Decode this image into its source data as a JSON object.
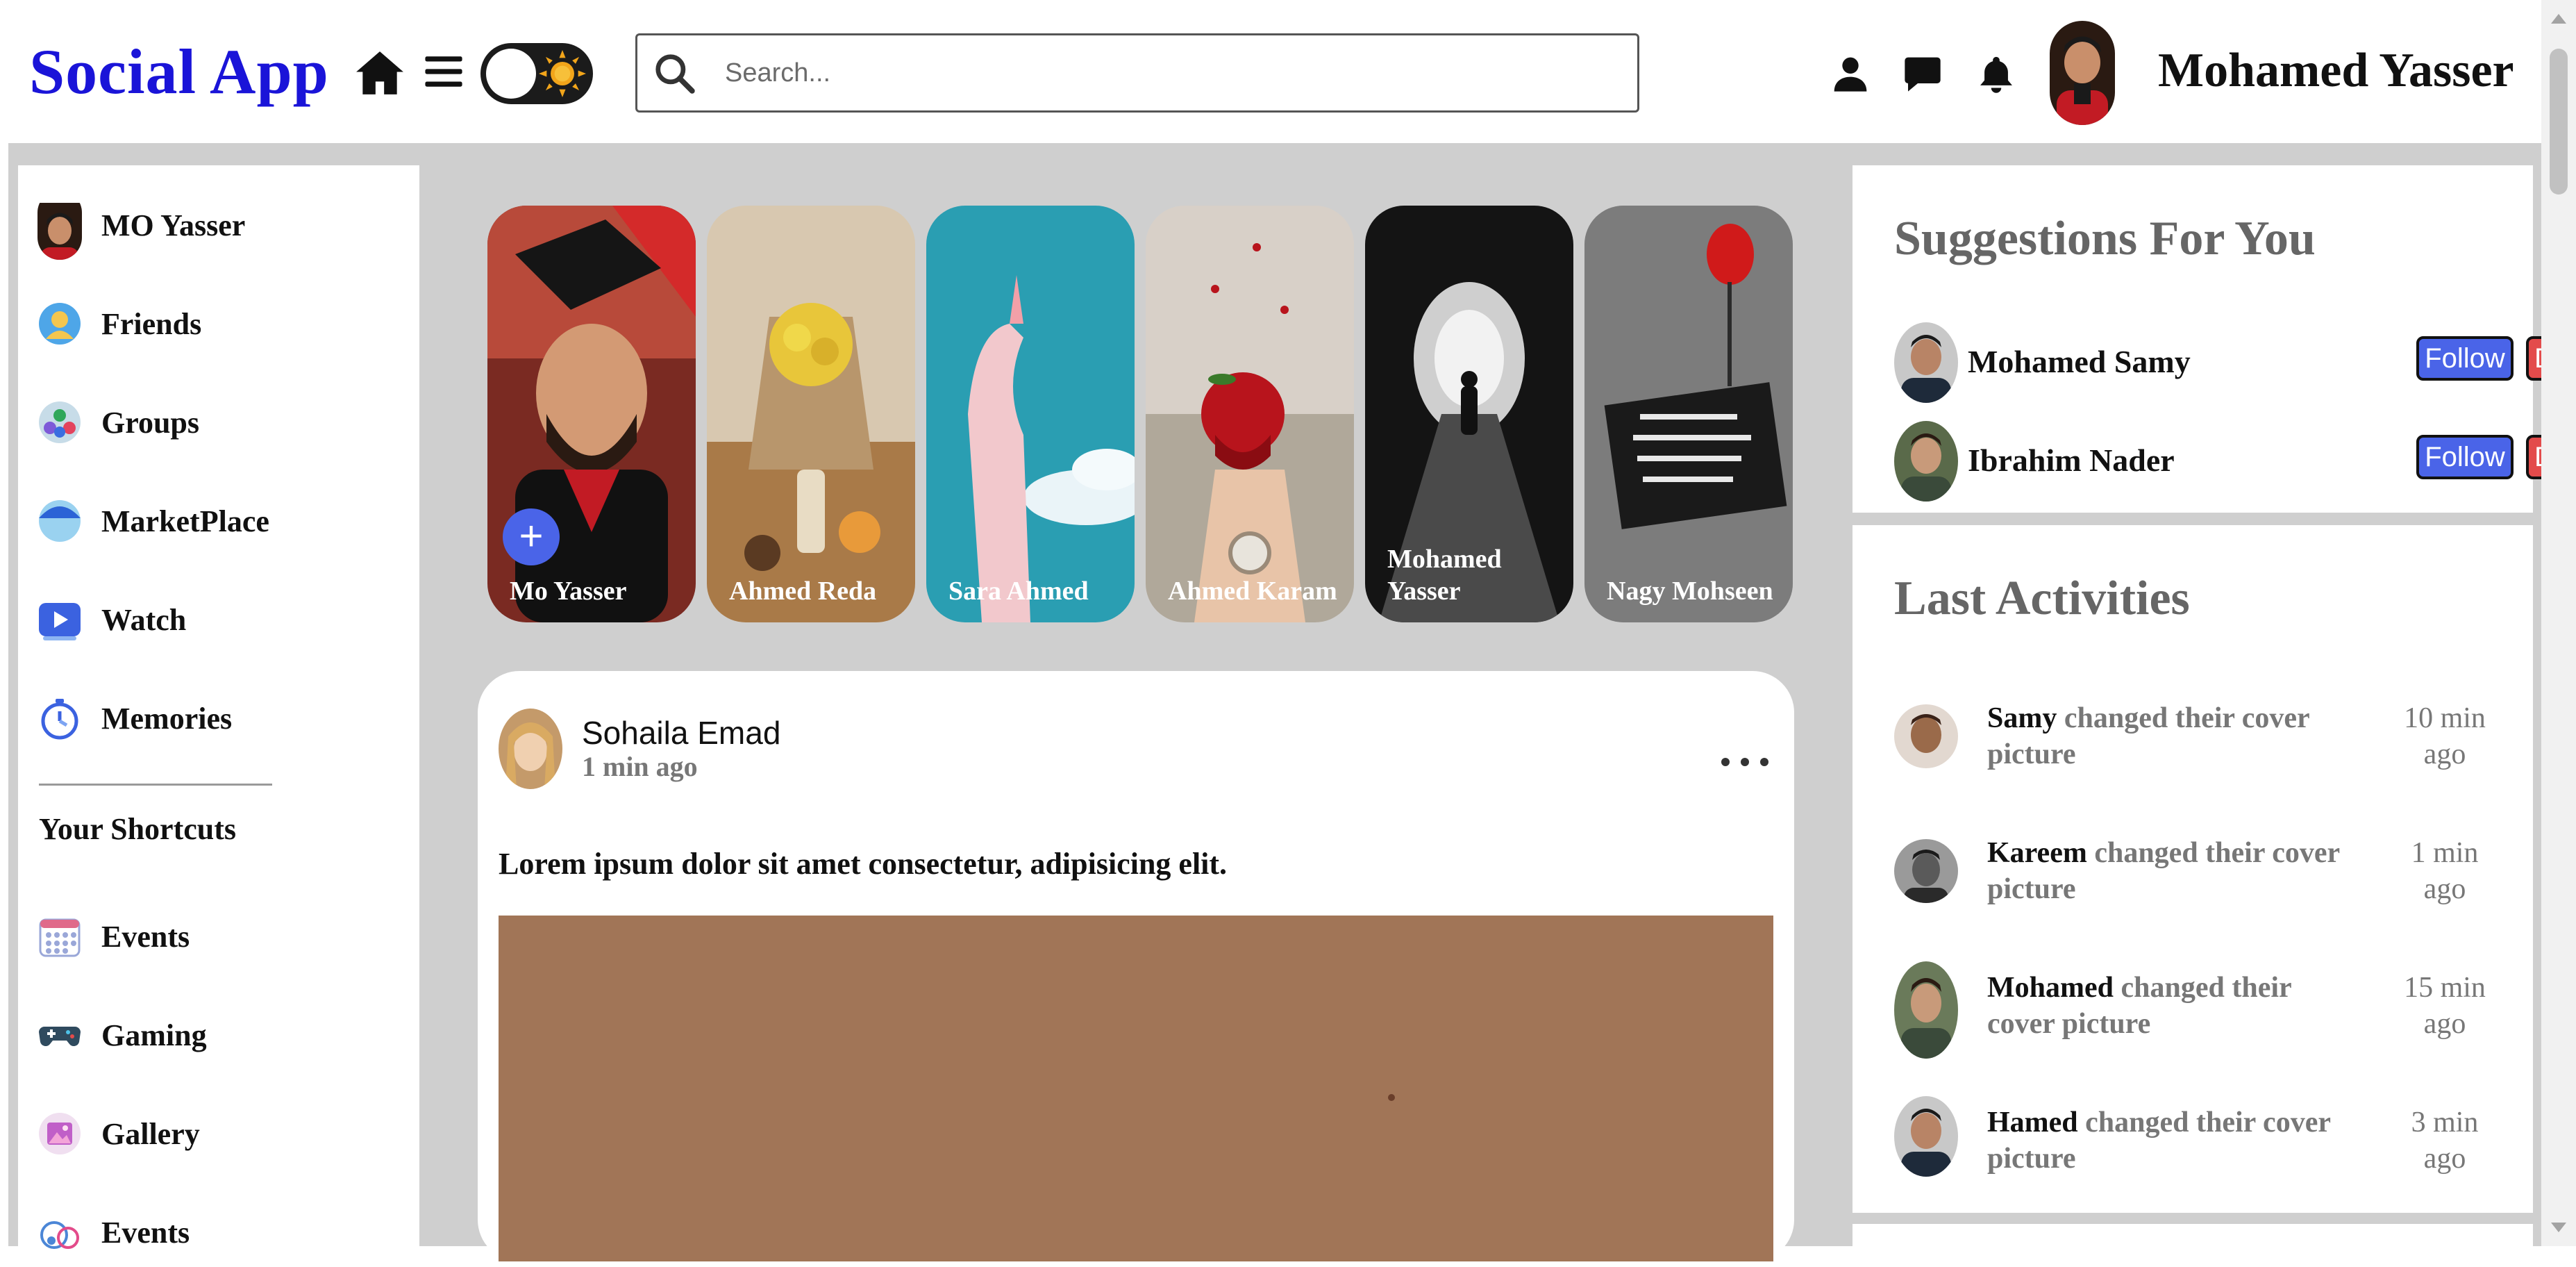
{
  "nav": {
    "logo": "Social App",
    "search_placeholder": "Search...",
    "username": "Mohamed Yasser",
    "icons": [
      "home-icon",
      "menu-icon",
      "theme-toggle",
      "search-icon",
      "user-icon",
      "chat-icon",
      "bell-icon"
    ]
  },
  "sidebar": {
    "items": [
      {
        "label": "MO Yasser",
        "icon": "avatar"
      },
      {
        "label": "Friends",
        "icon": "friends-icon"
      },
      {
        "label": "Groups",
        "icon": "groups-icon"
      },
      {
        "label": "MarketPlace",
        "icon": "marketplace-icon"
      },
      {
        "label": "Watch",
        "icon": "watch-icon"
      },
      {
        "label": "Memories",
        "icon": "memories-icon"
      }
    ],
    "shortcuts_heading": "Your Shortcuts",
    "shortcuts": [
      {
        "label": "Events",
        "icon": "events-icon"
      },
      {
        "label": "Gaming",
        "icon": "gaming-icon"
      },
      {
        "label": "Gallery",
        "icon": "gallery-icon"
      },
      {
        "label": "Events",
        "icon": "events-icon"
      }
    ]
  },
  "stories": [
    {
      "name": "Mo Yasser",
      "add": true
    },
    {
      "name": "Ahmed Reda"
    },
    {
      "name": "Sara Ahmed"
    },
    {
      "name": "Ahmed Karam"
    },
    {
      "name": "Mohamed Yasser"
    },
    {
      "name": "Nagy Mohseen"
    }
  ],
  "post": {
    "author": "Sohaila Emad",
    "time": "1 min ago",
    "text": "Lorem ipsum dolor sit amet consectetur, adipisicing elit."
  },
  "suggestions": {
    "title": "Suggestions For You",
    "follow_label": "Follow",
    "dismiss_label": "Dismiss",
    "people": [
      {
        "name": "Mohamed Samy"
      },
      {
        "name": "Ibrahim Nader"
      }
    ]
  },
  "activities": {
    "title": "Last Activities",
    "items": [
      {
        "who": "Samy",
        "action": "changed their cover picture",
        "when": "10 min ago"
      },
      {
        "who": "Kareem",
        "action": "changed their cover picture",
        "when": "1 min ago"
      },
      {
        "who": "Mohamed",
        "action": "changed their cover picture",
        "when": "15 min ago"
      },
      {
        "who": "Hamed",
        "action": "changed their cover picture",
        "when": "3 min ago"
      }
    ]
  },
  "colors": {
    "brand": "#1a14d8",
    "accent_blue": "#4a64e8",
    "dismiss_red": "#e34b4b",
    "background": "#cfcfcf"
  }
}
